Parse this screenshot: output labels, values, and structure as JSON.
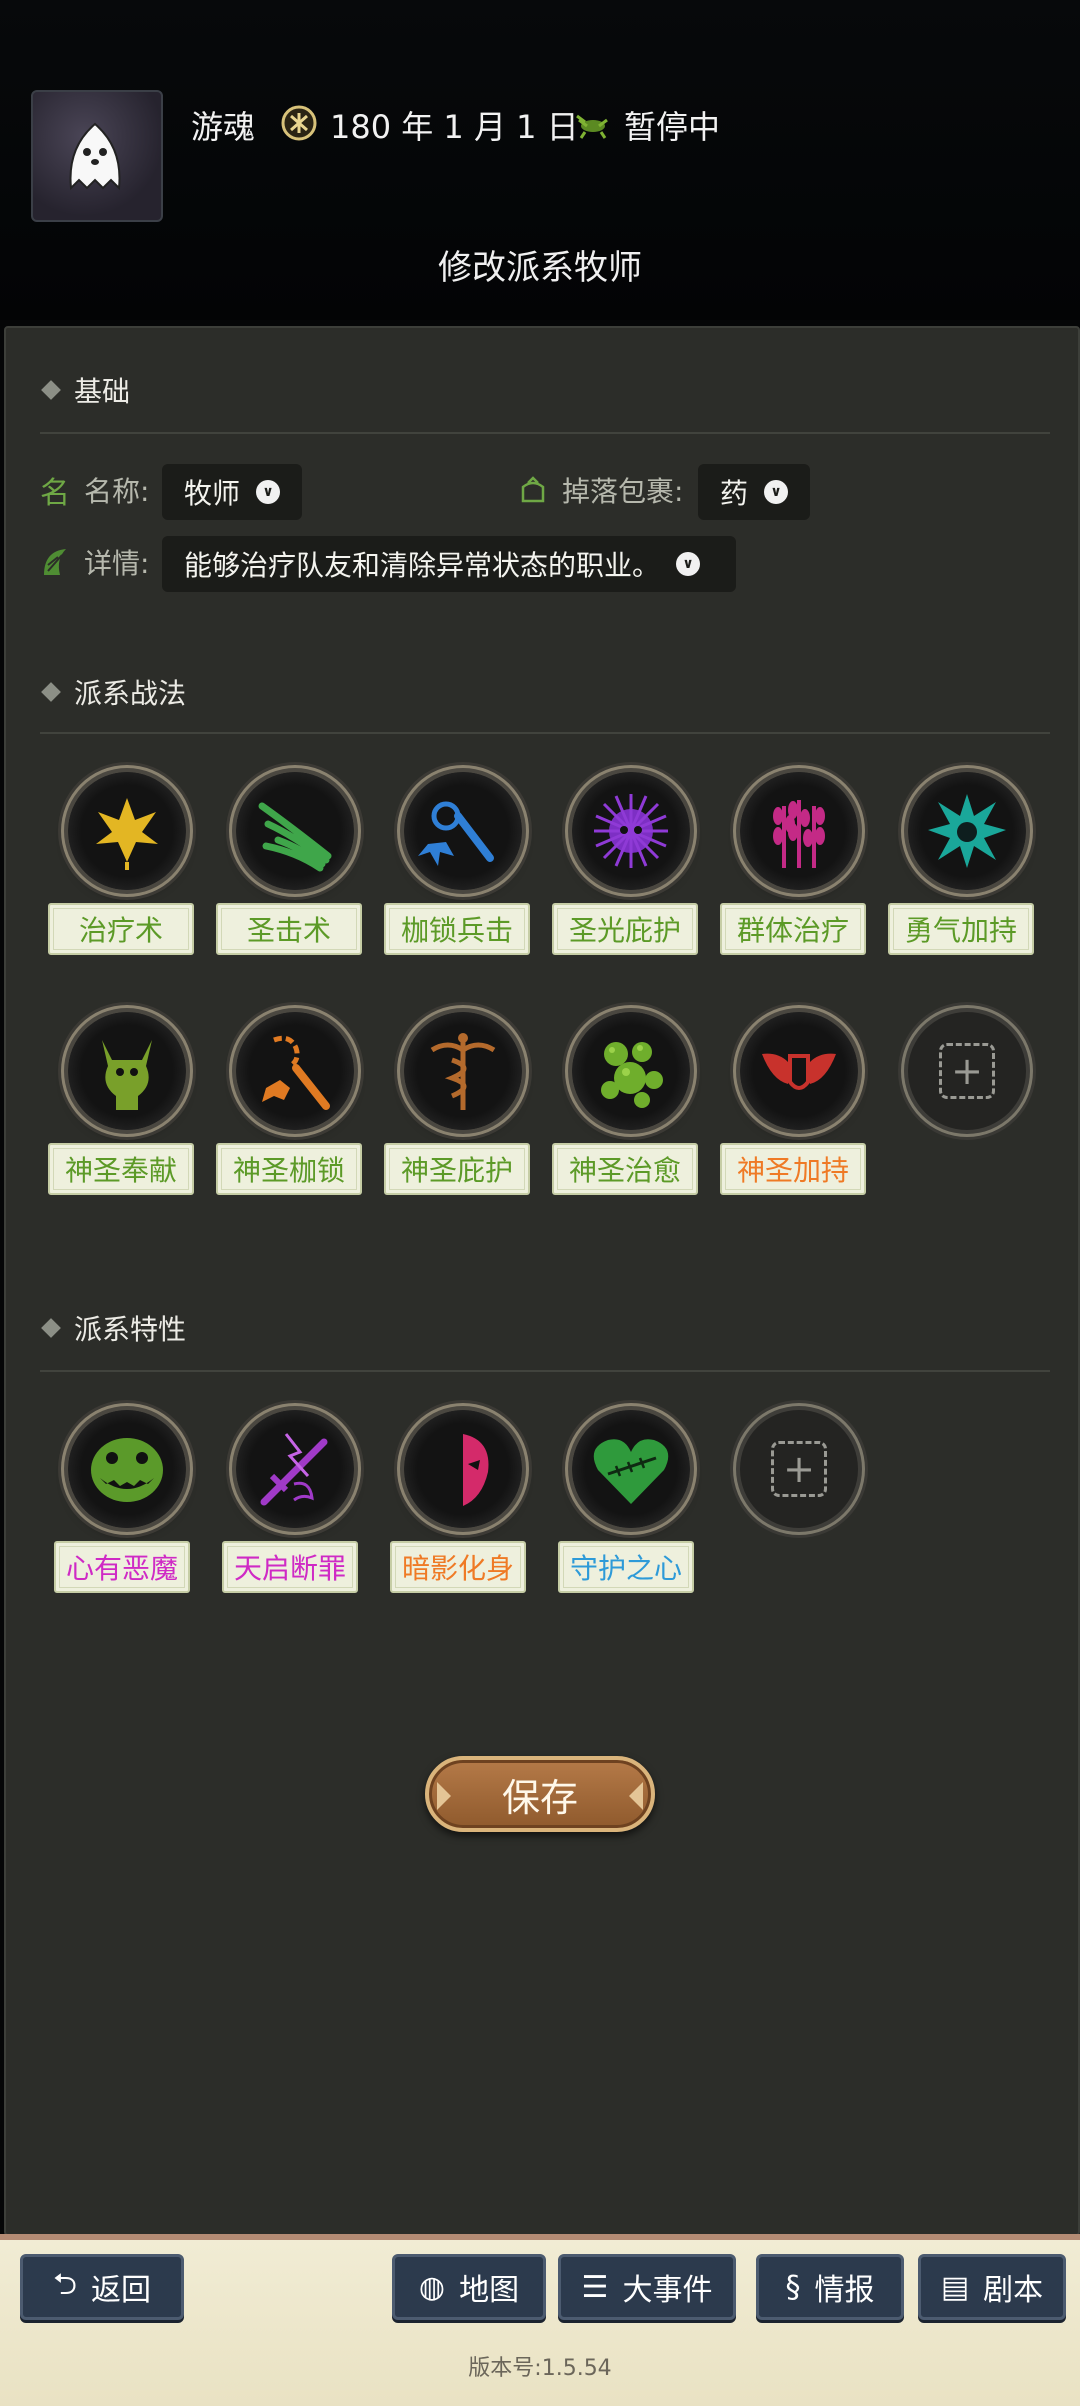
{
  "header": {
    "username": "游魂",
    "date": "180 年 1 月 1 日",
    "status": "暂停中",
    "title": "修改派系牧师"
  },
  "basic": {
    "heading": "基础",
    "name_label": "名称:",
    "name_value": "牧师",
    "drop_label": "掉落包裹:",
    "drop_value": "药",
    "detail_label": "详情:",
    "detail_value": "能够治疗队友和清除异常状态的职业。"
  },
  "tactics": {
    "heading": "派系战法",
    "items": [
      {
        "label": "治疗术",
        "color": "#5c9a27",
        "icon": "leaf-icon"
      },
      {
        "label": "圣击术",
        "color": "#5c9a27",
        "icon": "claw-slash-icon"
      },
      {
        "label": "枷锁兵击",
        "color": "#5c9a27",
        "icon": "chain-flail-icon"
      },
      {
        "label": "圣光庇护",
        "color": "#5c9a27",
        "icon": "spiky-burst-icon"
      },
      {
        "label": "群体治疗",
        "color": "#5c9a27",
        "icon": "wheat-icon"
      },
      {
        "label": "勇气加持",
        "color": "#5c9a27",
        "icon": "teal-burst-icon"
      },
      {
        "label": "神圣奉献",
        "color": "#5c9a27",
        "icon": "horned-figure-icon"
      },
      {
        "label": "神圣枷锁",
        "color": "#5c9a27",
        "icon": "mace-chain-icon"
      },
      {
        "label": "神圣庇护",
        "color": "#5c9a27",
        "icon": "caduceus-icon"
      },
      {
        "label": "神圣治愈",
        "color": "#5c9a27",
        "icon": "bubbles-icon"
      },
      {
        "label": "神圣加持",
        "color": "#ef7a25",
        "icon": "winged-shield-icon"
      }
    ]
  },
  "traits": {
    "heading": "派系特性",
    "items": [
      {
        "label": "心有恶魔",
        "color": "#cf2ac5",
        "icon": "demon-grin-icon"
      },
      {
        "label": "天启断罪",
        "color": "#cf2ac5",
        "icon": "lightning-sword-icon"
      },
      {
        "label": "暗影化身",
        "color": "#ef7a25",
        "icon": "half-mask-icon"
      },
      {
        "label": "守护之心",
        "color": "#2d9ad8",
        "icon": "stitched-heart-icon"
      }
    ]
  },
  "actions": {
    "save": "保存"
  },
  "nav": {
    "back": "返回",
    "map": "地图",
    "events": "大事件",
    "intel": "情报",
    "script": "剧本"
  },
  "version": "版本号:1.5.54"
}
